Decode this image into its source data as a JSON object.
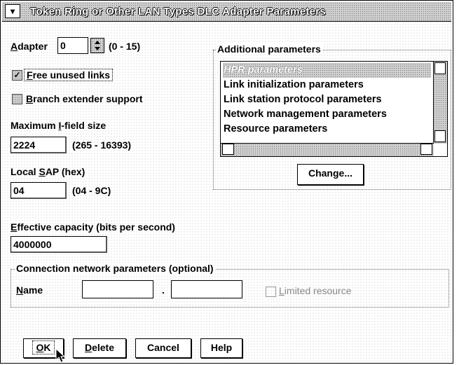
{
  "window": {
    "title": "Token Ring or Other LAN Types DLC Adapter Parameters",
    "sysmenu_glyph": "▾"
  },
  "adapter": {
    "label_prefix": "",
    "label_mnemonic": "A",
    "label_rest": "dapter",
    "value": "0",
    "range": "(0 - 15)"
  },
  "checkboxes": {
    "free_unused_links": {
      "mnemonic": "F",
      "rest": "ree unused links",
      "checked": true,
      "mark": "✓"
    },
    "branch_extender": {
      "mnemonic": "B",
      "rest": "ranch extender support",
      "checked": false,
      "mark": ""
    },
    "limited_resource": {
      "mnemonic": "L",
      "rest": "imited resource",
      "checked": false,
      "mark": ""
    }
  },
  "max_ifield": {
    "label_prefix": "Maximum ",
    "label_mnemonic": "I",
    "label_rest": "-field size",
    "value": "2224",
    "range": "(265 - 16393)"
  },
  "local_sap": {
    "label_prefix": "Local ",
    "label_mnemonic": "S",
    "label_rest": "AP (hex)",
    "value": "04",
    "range": "(04 - 9C)"
  },
  "additional": {
    "group_label": "Additional parameters",
    "items": [
      "HPR parameters",
      "Link initialization parameters",
      "Link station protocol parameters",
      "Network management parameters",
      "Resource parameters"
    ],
    "selected_index": 0,
    "change_button": "Change..."
  },
  "effective_capacity": {
    "label_mnemonic": "E",
    "label_rest": "ffective capacity (bits per second)",
    "value": "4000000"
  },
  "connection_network": {
    "group_label": "Connection network parameters (optional)",
    "name_mnemonic": "N",
    "name_rest": "ame",
    "name_value_1": "",
    "separator": ".",
    "name_value_2": ""
  },
  "buttons": {
    "ok": {
      "mnemonic": "O",
      "rest": "K"
    },
    "delete": {
      "mnemonic": "D",
      "rest": "elete"
    },
    "cancel": {
      "mnemonic": "",
      "rest": "Cancel"
    },
    "help": {
      "mnemonic": "",
      "rest": "Help"
    }
  }
}
